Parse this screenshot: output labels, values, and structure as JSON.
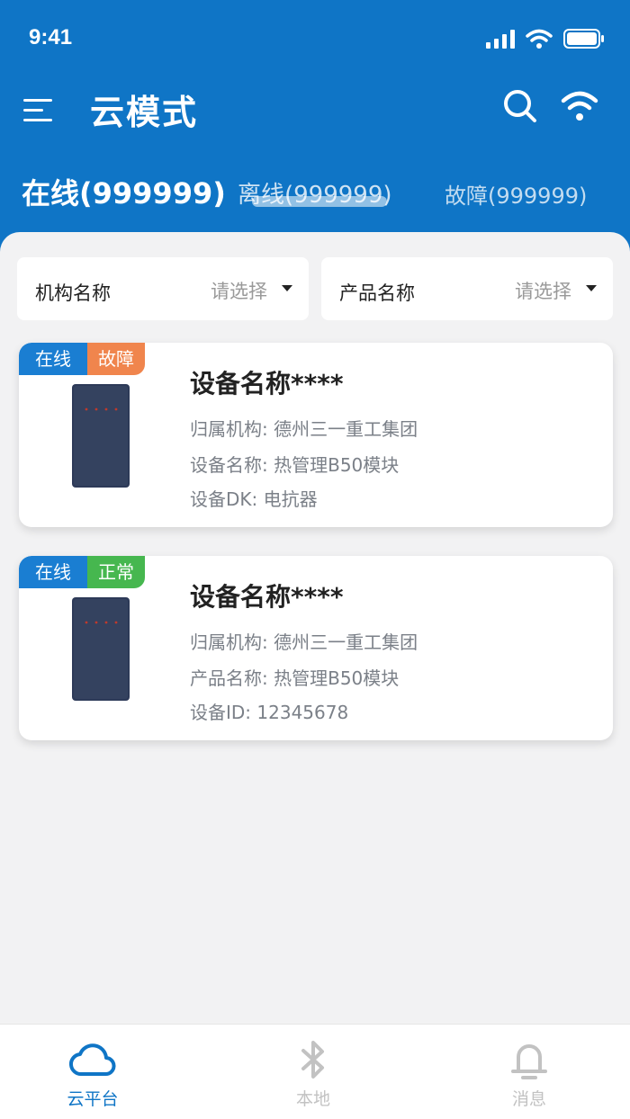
{
  "status_bar": {
    "time": "9:41"
  },
  "nav": {
    "title": "云模式"
  },
  "tabs": [
    {
      "label": "在线(999999)",
      "active": true
    },
    {
      "label": "离线(999999)",
      "active": false
    },
    {
      "label": "故障(999999)",
      "active": false
    }
  ],
  "filters": {
    "org": {
      "label": "机构名称",
      "placeholder": "请选择"
    },
    "product": {
      "label": "产品名称",
      "placeholder": "请选择"
    }
  },
  "devices": [
    {
      "status": "在线",
      "condition": "故障",
      "name": "设备名称****",
      "line1": "归属机构: 德州三一重工集团",
      "line2": "设备名称: 热管理B50模块",
      "line3": "设备DK:   电抗器"
    },
    {
      "status": "在线",
      "condition": "正常",
      "name": "设备名称****",
      "line1": "归属机构: 德州三一重工集团",
      "line2": "产品名称: 热管理B50模块",
      "line3": "设备ID:   12345678"
    }
  ],
  "bottom_nav": [
    {
      "label": "云平台",
      "icon": "cloud-icon",
      "active": true
    },
    {
      "label": "本地",
      "icon": "bluetooth-icon",
      "active": false
    },
    {
      "label": "消息",
      "icon": "bell-icon",
      "active": false
    }
  ],
  "colors": {
    "primary": "#0f75c6",
    "online": "#1a7ed2",
    "fault": "#f0854d",
    "normal": "#46b74f",
    "background": "#f2f2f3"
  }
}
